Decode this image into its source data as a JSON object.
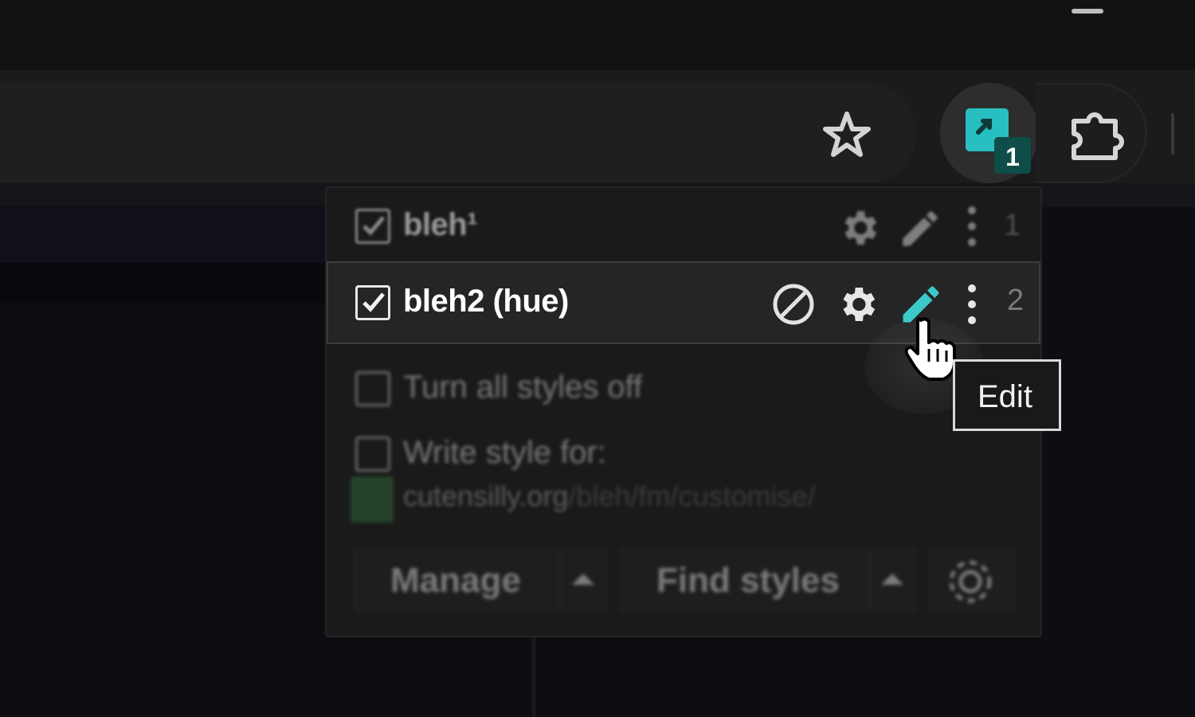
{
  "browser": {
    "extension_badge": "1"
  },
  "popup": {
    "styles": [
      {
        "name": "bleh¹",
        "number": "1",
        "enabled": true
      },
      {
        "name": "bleh2 (hue)",
        "number": "2",
        "enabled": true
      }
    ],
    "options": {
      "turn_all_off": "Turn all styles off",
      "write_style_for": "Write style for:",
      "url_domain": "cutensilly.org",
      "url_path": "/bleh/fm/customise/"
    },
    "buttons": {
      "manage": "Manage",
      "find_styles": "Find styles"
    }
  },
  "tooltip": {
    "text": "Edit"
  },
  "colors": {
    "accent": "#36c7c9",
    "background": "#0e0d14",
    "popup": "#1a1a1a"
  }
}
